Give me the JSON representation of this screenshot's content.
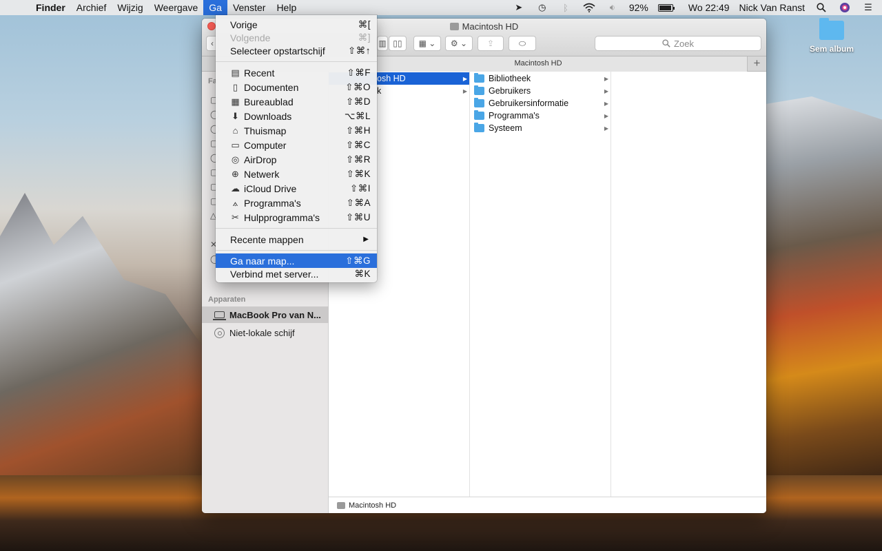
{
  "menubar": {
    "app_name": "Finder",
    "items": [
      "Archief",
      "Wijzig",
      "Weergave",
      "Ga",
      "Venster",
      "Help"
    ],
    "battery_percent": "92%",
    "battery_level": 0.92,
    "clock": "Wo 22:49",
    "user": "Nick Van Ranst"
  },
  "desktop": {
    "folder_label": "Sem album"
  },
  "window": {
    "title": "Macintosh HD",
    "search_placeholder": "Zoek",
    "tab_title": "Macintosh HD",
    "sidebar": {
      "partial_heading": "Fa",
      "devices_heading_partial": "Apparaten",
      "devices": [
        {
          "label": "MacBook Pro van N...",
          "icon": "laptop-icon",
          "selected": true
        },
        {
          "label": "Niet-lokale schijf",
          "icon": "disc-icon",
          "selected": false
        }
      ]
    },
    "columns": {
      "col1": [
        {
          "label": "osh HD",
          "selected": true
        },
        {
          "label": "k",
          "selected": false
        }
      ],
      "col2": [
        {
          "label": "Bibliotheek"
        },
        {
          "label": "Gebruikers"
        },
        {
          "label": "Gebruikersinformatie"
        },
        {
          "label": "Programma's"
        },
        {
          "label": "Systeem"
        }
      ]
    },
    "pathbar": "Macintosh HD"
  },
  "go_menu": {
    "items": [
      {
        "label": "Vorige",
        "shortcut": "⌘[",
        "disabled": false
      },
      {
        "label": "Volgende",
        "shortcut": "⌘]",
        "disabled": true
      },
      {
        "label": "Selecteer opstartschijf",
        "shortcut": "⇧⌘↑",
        "disabled": false
      },
      {
        "label": "Recent",
        "shortcut": "⇧⌘F",
        "icon": "recent-icon"
      },
      {
        "label": "Documenten",
        "shortcut": "⇧⌘O",
        "icon": "documents-icon"
      },
      {
        "label": "Bureaublad",
        "shortcut": "⇧⌘D",
        "icon": "desktop-icon"
      },
      {
        "label": "Downloads",
        "shortcut": "⌥⌘L",
        "icon": "downloads-icon"
      },
      {
        "label": "Thuismap",
        "shortcut": "⇧⌘H",
        "icon": "home-icon"
      },
      {
        "label": "Computer",
        "shortcut": "⇧⌘C",
        "icon": "computer-icon"
      },
      {
        "label": "AirDrop",
        "shortcut": "⇧⌘R",
        "icon": "airdrop-icon"
      },
      {
        "label": "Netwerk",
        "shortcut": "⇧⌘K",
        "icon": "network-icon"
      },
      {
        "label": "iCloud Drive",
        "shortcut": "⇧⌘I",
        "icon": "cloud-icon"
      },
      {
        "label": "Programma's",
        "shortcut": "⇧⌘A",
        "icon": "applications-icon"
      },
      {
        "label": "Hulpprogramma's",
        "shortcut": "⇧⌘U",
        "icon": "utilities-icon"
      },
      {
        "label": "Recente mappen",
        "submenu": true
      },
      {
        "label": "Ga naar map...",
        "shortcut": "⇧⌘G",
        "highlighted": true
      },
      {
        "label": "Verbind met server...",
        "shortcut": "⌘K"
      }
    ]
  }
}
